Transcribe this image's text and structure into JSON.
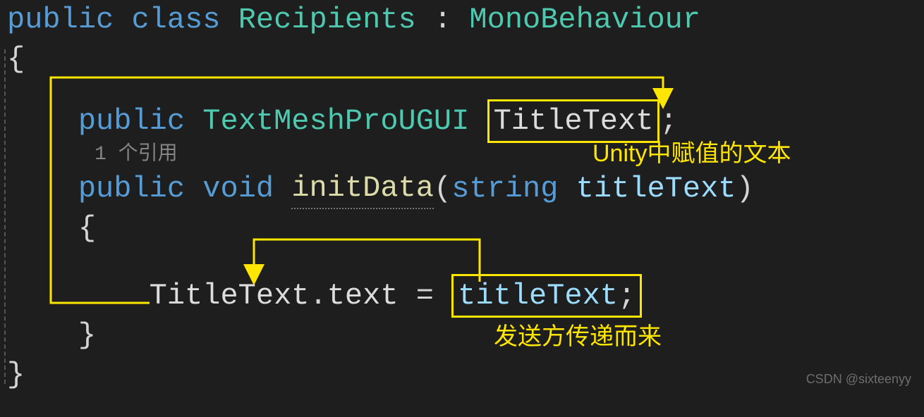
{
  "code": {
    "line1": {
      "kw_public": "public",
      "kw_class": "class",
      "classname": "Recipients",
      "colon": ":",
      "basetype": "MonoBehaviour"
    },
    "open_brace": "{",
    "line3": {
      "kw_public": "public",
      "type": "TextMeshProUGUI",
      "field": "TitleText",
      "semi": ";"
    },
    "references": "1 个引用",
    "line5": {
      "kw_public": "public",
      "kw_void": "void",
      "method": "initData",
      "lparen": "(",
      "ptype": "string",
      "pname": "titleText",
      "rparen": ")"
    },
    "open_brace2": "{",
    "line7": {
      "target": "TitleText",
      "dot": ".",
      "prop": "text",
      "eq": " = ",
      "val": "titleText",
      "semi": ";"
    },
    "close_brace2": "}",
    "close_brace": "}"
  },
  "annotations": {
    "top": "Unity中赋值的文本",
    "bottom": "发送方传递而来"
  },
  "watermark": "CSDN @sixteenyy"
}
